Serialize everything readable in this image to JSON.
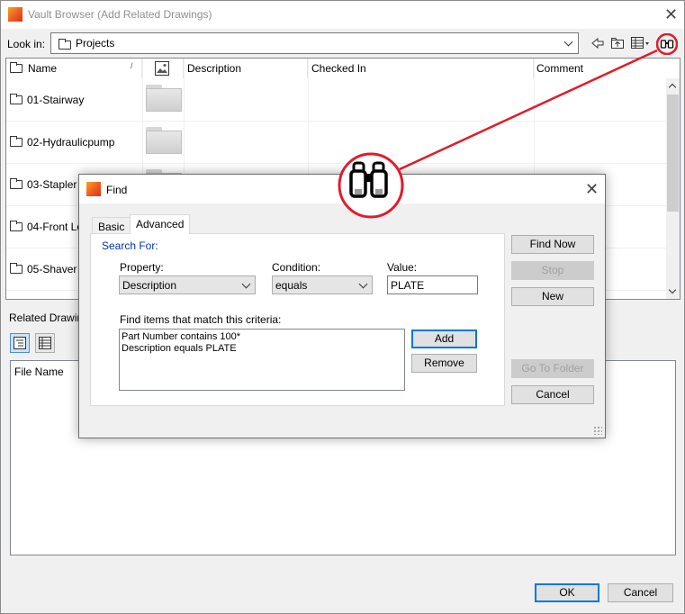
{
  "window": {
    "title": "Vault Browser (Add Related Drawings)",
    "close_glyph": "✕"
  },
  "lookin": {
    "label": "Look in:",
    "value": "Projects"
  },
  "columns": {
    "name": "Name",
    "sort_glyph": "/",
    "description": "Description",
    "checked_in": "Checked In",
    "comment": "Comment"
  },
  "rows": [
    {
      "name": "01-Stairway"
    },
    {
      "name": "02-Hydraulicpump"
    },
    {
      "name": "03-Stapler"
    },
    {
      "name": "04-Front Lo"
    },
    {
      "name": "05-Shaver"
    }
  ],
  "related": {
    "label": "Related Drawing",
    "file_name_header": "File Name"
  },
  "footer": {
    "ok": "OK",
    "cancel": "Cancel"
  },
  "find": {
    "title": "Find",
    "close_glyph": "✕",
    "tabs": {
      "basic": "Basic",
      "advanced": "Advanced"
    },
    "search_for": "Search For:",
    "property_label": "Property:",
    "property_value": "Description",
    "condition_label": "Condition:",
    "condition_value": "equals",
    "value_label": "Value:",
    "value_value": "PLATE",
    "criteria_label": "Find items that match this criteria:",
    "criteria": [
      "Part Number contains 100*",
      "Description equals PLATE"
    ],
    "add": "Add",
    "remove": "Remove",
    "find_now": "Find Now",
    "stop": "Stop",
    "new": "New",
    "go_to_folder": "Go To Folder",
    "cancel": "Cancel"
  },
  "colors": {
    "accent": "#0078d7",
    "callout": "#e21b2b",
    "link_blue": "#0033aa"
  }
}
